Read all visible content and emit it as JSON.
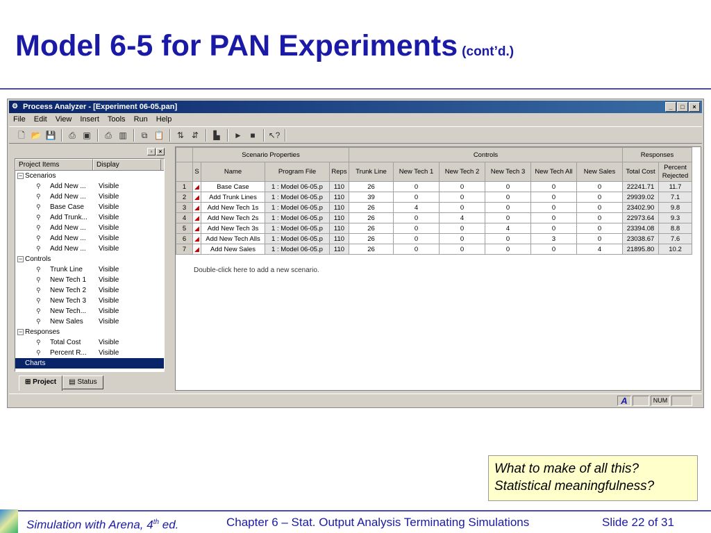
{
  "slide": {
    "title": "Model 6-5 for PAN Experiments",
    "title_sub": "(cont’d.)",
    "callout_lines": [
      "What to make of all this?",
      "Statistical meaningfulness?"
    ],
    "footer": {
      "book_prefix": "Simulation with Arena, 4",
      "book_sup": "th",
      "book_suffix": " ed.",
      "chapter": "Chapter 6 – Stat. Output Analysis Terminating Simulations",
      "slide_num": "Slide 22 of 31"
    }
  },
  "window": {
    "title": "Process Analyzer - [Experiment 06-05.pan]",
    "menu": [
      "File",
      "Edit",
      "View",
      "Insert",
      "Tools",
      "Run",
      "Help"
    ]
  },
  "tree": {
    "col_items": "Project Items",
    "col_display": "Display",
    "groups": [
      {
        "label": "Scenarios",
        "items": [
          {
            "label": "Add New ...",
            "display": "Visible"
          },
          {
            "label": "Add New ...",
            "display": "Visible"
          },
          {
            "label": "Base Case",
            "display": "Visible"
          },
          {
            "label": "Add Trunk...",
            "display": "Visible"
          },
          {
            "label": "Add New ...",
            "display": "Visible"
          },
          {
            "label": "Add New ...",
            "display": "Visible"
          },
          {
            "label": "Add New ...",
            "display": "Visible"
          }
        ]
      },
      {
        "label": "Controls",
        "items": [
          {
            "label": "Trunk Line",
            "display": "Visible"
          },
          {
            "label": "New Tech 1",
            "display": "Visible"
          },
          {
            "label": "New Tech 2",
            "display": "Visible"
          },
          {
            "label": "New Tech 3",
            "display": "Visible"
          },
          {
            "label": "New Tech...",
            "display": "Visible"
          },
          {
            "label": "New Sales",
            "display": "Visible"
          }
        ]
      },
      {
        "label": "Responses",
        "items": [
          {
            "label": "Total Cost",
            "display": "Visible"
          },
          {
            "label": "Percent R...",
            "display": "Visible"
          }
        ]
      }
    ],
    "selected": "Charts",
    "tabs": [
      "Project",
      "Status"
    ]
  },
  "grid": {
    "group_headers": [
      "Scenario Properties",
      "Controls",
      "Responses"
    ],
    "columns": [
      "S",
      "Name",
      "Program File",
      "Reps",
      "Trunk Line",
      "New Tech 1",
      "New Tech 2",
      "New Tech 3",
      "New Tech All",
      "New Sales",
      "Total Cost",
      "Percent Rejected"
    ],
    "rows": [
      [
        "1",
        "Base Case",
        "1 : Model 06-05.p",
        "110",
        "26",
        "0",
        "0",
        "0",
        "0",
        "0",
        "22241.71",
        "11.7"
      ],
      [
        "2",
        "Add Trunk Lines",
        "1 : Model 06-05.p",
        "110",
        "39",
        "0",
        "0",
        "0",
        "0",
        "0",
        "29939.02",
        "7.1"
      ],
      [
        "3",
        "Add New Tech 1s",
        "1 : Model 06-05.p",
        "110",
        "26",
        "4",
        "0",
        "0",
        "0",
        "0",
        "23402.90",
        "9.8"
      ],
      [
        "4",
        "Add New Tech 2s",
        "1 : Model 06-05.p",
        "110",
        "26",
        "0",
        "4",
        "0",
        "0",
        "0",
        "22973.64",
        "9.3"
      ],
      [
        "5",
        "Add New Tech 3s",
        "1 : Model 06-05.p",
        "110",
        "26",
        "0",
        "0",
        "4",
        "0",
        "0",
        "23394.08",
        "8.8"
      ],
      [
        "6",
        "Add New Tech Alls",
        "1 : Model 06-05.p",
        "110",
        "26",
        "0",
        "0",
        "0",
        "3",
        "0",
        "23038.67",
        "7.6"
      ],
      [
        "7",
        "Add New Sales",
        "1 : Model 06-05.p",
        "110",
        "26",
        "0",
        "0",
        "0",
        "0",
        "4",
        "21895.80",
        "10.2"
      ]
    ],
    "hint": "Double-click here to add a new scenario."
  },
  "statusbar": {
    "font_indicator": "A",
    "num": "NUM"
  }
}
